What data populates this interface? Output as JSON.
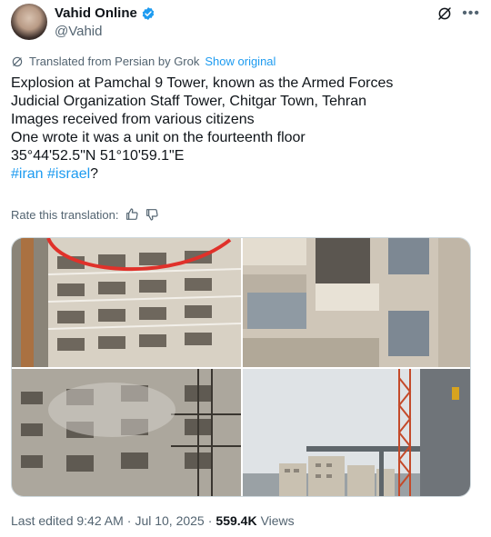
{
  "author": {
    "display_name": "Vahid Online",
    "handle": "@Vahid"
  },
  "translation": {
    "label": "Translated from Persian by Grok",
    "show_original": "Show original"
  },
  "tweet": {
    "line1": "Explosion at Pamchal 9 Tower, known as the Armed Forces",
    "line2": "Judicial Organization Staff Tower, Chitgar Town, Tehran",
    "line3": "Images received from various citizens",
    "line4": "One wrote it was a unit on the fourteenth floor",
    "line5": "35°44'52.5\"N 51°10'59.1\"E",
    "hashtag1": "#iran",
    "hashtag2": "#israel",
    "trailing": "?"
  },
  "rate": {
    "label": "Rate this translation:"
  },
  "icons": {
    "verified": "verified-badge-icon",
    "grok": "grok-icon",
    "more": "more-icon",
    "translate": "translate-icon",
    "thumbs_up": "thumbs-up-icon",
    "thumbs_down": "thumbs-down-icon"
  },
  "footer": {
    "edited": "Last edited 9:42 AM",
    "separator1": "·",
    "date": "Jul 10, 2025",
    "separator2": "·",
    "views_count": "559.4K",
    "views_label": "Views"
  },
  "colors": {
    "accent": "#1d9bf0",
    "secondary_text": "#536471",
    "primary_text": "#0f1419"
  }
}
